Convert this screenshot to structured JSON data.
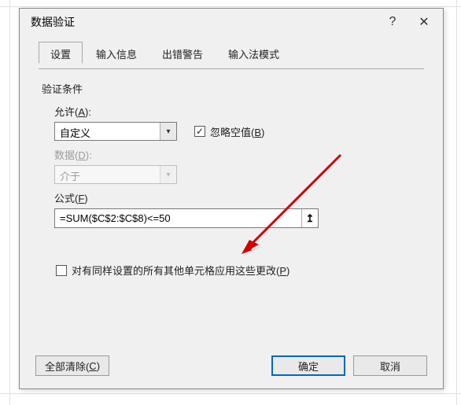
{
  "dialog": {
    "title": "数据验证",
    "help": "?",
    "close": "✕"
  },
  "tabs": {
    "settings": "设置",
    "input_msg": "输入信息",
    "error_alert": "出错警告",
    "ime_mode": "输入法模式"
  },
  "criteria": {
    "section": "验证条件",
    "allow_label_text": "允许(",
    "allow_key": "A",
    "allow_label_close": "):",
    "allow_value": "自定义",
    "ignore_blank_label_pre": "忽略空值(",
    "ignore_blank_key": "B",
    "ignore_blank_label_post": ")",
    "ignore_blank_check": "✓",
    "data_label_text": "数据(",
    "data_key": "D",
    "data_label_close": "):",
    "data_value": "介于",
    "formula_label_text": "公式(",
    "formula_key": "F",
    "formula_label_close": ")",
    "formula_value": "=SUM($C$2:$C$8)<=50"
  },
  "apply": {
    "label_pre": "对有同样设置的所有其他单元格应用这些更改(",
    "key": "P",
    "label_post": ")"
  },
  "buttons": {
    "clear_all_pre": "全部清除(",
    "clear_all_key": "C",
    "clear_all_post": ")",
    "ok": "确定",
    "cancel": "取消"
  },
  "icons": {
    "dropdown": "▾",
    "ref_picker": "↥"
  }
}
